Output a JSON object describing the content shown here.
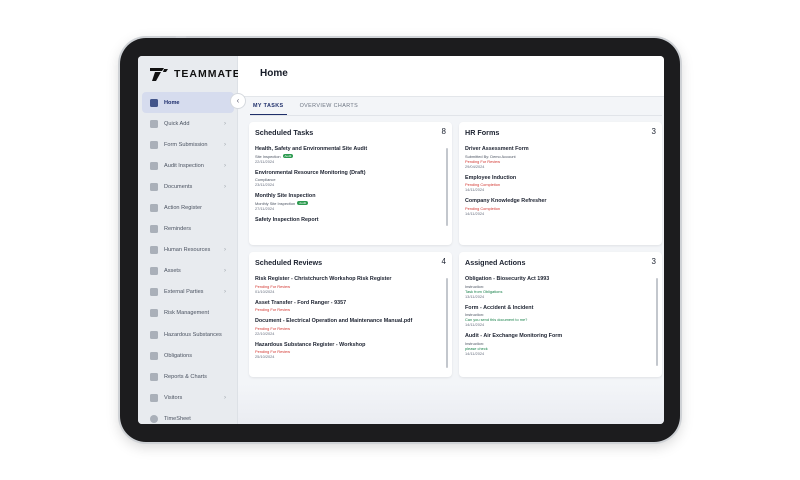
{
  "app": {
    "brand": "TEAMMATE"
  },
  "header": {
    "title": "Home"
  },
  "tabs": [
    {
      "label": "MY TASKS"
    },
    {
      "label": "OVERVIEW CHARTS"
    }
  ],
  "sidebar": {
    "items": [
      {
        "label": "Home",
        "icon": "home-icon",
        "active": true
      },
      {
        "label": "Quick Add",
        "icon": "quick-add-icon"
      },
      {
        "label": "Form Submission",
        "icon": "form-icon"
      },
      {
        "label": "Audit Inspection",
        "icon": "audit-icon"
      },
      {
        "label": "Documents",
        "icon": "document-icon"
      },
      {
        "label": "Action Register",
        "icon": "action-icon"
      },
      {
        "label": "Reminders",
        "icon": "reminder-icon"
      },
      {
        "label": "Human Resources",
        "icon": "people-icon"
      },
      {
        "label": "Assets",
        "icon": "assets-icon"
      },
      {
        "label": "External Parties",
        "icon": "external-icon"
      },
      {
        "label": "Risk Management",
        "icon": "risk-icon"
      },
      {
        "label": "Hazardous Substances",
        "icon": "hazard-icon"
      },
      {
        "label": "Obligations",
        "icon": "obligation-icon"
      },
      {
        "label": "Reports & Charts",
        "icon": "chart-icon"
      },
      {
        "label": "Visitors",
        "icon": "visitor-icon"
      },
      {
        "label": "TimeSheet",
        "icon": "clock-icon"
      }
    ]
  },
  "scheduled_tasks": {
    "title": "Scheduled Tasks",
    "count": "8",
    "items": [
      {
        "title": "Health, Safety and Environmental Site Audit",
        "sub": "Site Inspection",
        "badge": "Audit",
        "date": "22/11/2024"
      },
      {
        "title": "Environmental Resource Monitoring (Draft)",
        "sub": "Compliance",
        "date": "23/11/2024"
      },
      {
        "title": "Monthly Site Inspection",
        "sub": "Monthly Site Inspection",
        "badge": "Audit",
        "date": "27/11/2024"
      },
      {
        "title": "Safety Inspection Report"
      }
    ]
  },
  "hr_forms": {
    "title": "HR Forms",
    "count": "3",
    "items": [
      {
        "title": "Driver Assessment Form",
        "sub": "Submitted By: Demo Account",
        "status": "Pending For Review",
        "date": "29/04/2024"
      },
      {
        "title": "Employee Induction",
        "status": "Pending Completion",
        "date": "14/11/2024"
      },
      {
        "title": "Company Knowledge Refresher",
        "status": "Pending Completion",
        "date": "14/11/2024"
      }
    ]
  },
  "scheduled_reviews": {
    "title": "Scheduled Reviews",
    "count": "4",
    "items": [
      {
        "title": "Risk Register - Christchurch Workshop Risk Register",
        "status": "Pending For Review",
        "date": "01/10/2024"
      },
      {
        "title": "Asset Transfer - Ford Ranger - 9357",
        "status": "Pending For Review"
      },
      {
        "title": "Document - Electrical Operation and Maintenance Manual.pdf",
        "status": "Pending For Review",
        "date": "22/10/2024"
      },
      {
        "title": "Hazardous Substance Register - Workshop",
        "status": "Pending For Review",
        "date": "25/10/2024"
      }
    ]
  },
  "assigned_actions": {
    "title": "Assigned Actions",
    "count": "3",
    "items": [
      {
        "title": "Obligation - Biosecurity Act 1993",
        "sub": "Instruction:",
        "note": "Task from Obligations",
        "date": "13/11/2024"
      },
      {
        "title": "Form - Accident & Incident",
        "sub": "Instruction:",
        "note": "Can you send this document to me?",
        "date": "14/11/2024"
      },
      {
        "title": "Audit - Air Exchange Monitoring Form",
        "sub": "Instruction:",
        "note": "please check",
        "date": "14/11/2024"
      }
    ]
  },
  "colors": {
    "accent": "#1f2f6a",
    "status_red": "#d2342e",
    "status_green": "#18814a",
    "badge_green": "#2c9a4f"
  }
}
